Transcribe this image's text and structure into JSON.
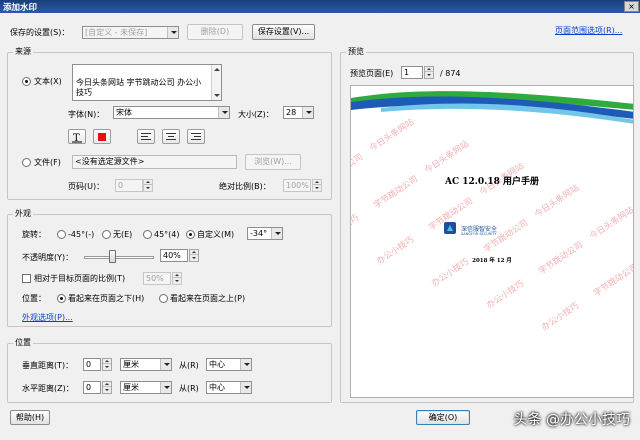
{
  "window": {
    "title": "添加水印",
    "close": "×"
  },
  "saved_settings": {
    "label": "保存的设置(S)：",
    "value": "[自定义 - 未保存]",
    "delete": "删除(D)",
    "save": "保存设置(V)..."
  },
  "page_range_link": "页面范围选项(R)...",
  "source": {
    "group_title": "来源",
    "text_radio": "文本(X)",
    "text_lines": [
      "今日头条网站  字节跳动公司  办公小",
      "技巧"
    ],
    "font_label": "字体(N)：",
    "font_value": "宋体",
    "size_label": "大小(Z)：",
    "size_value": "28",
    "file_radio": "文件(F)",
    "file_value": "<没有选定源文件>",
    "browse": "浏览(W)...",
    "page_label": "页码(U)：",
    "page_value": "0",
    "abs_scale_label": "绝对比例(B)：",
    "abs_scale_value": "100%"
  },
  "appearance": {
    "group_title": "外观",
    "rotation_label": "旋转：",
    "rot_neg45": "-45°(-)",
    "rot_none": "无(E)",
    "rot_45": "45°(4)",
    "rot_custom": "自定义(M)",
    "rot_value": "-34°",
    "opacity_label": "不透明度(Y)：",
    "opacity_value": "40%",
    "opacity_fraction": 0.4,
    "relative_label": "相对于目标页面的比例(T)",
    "relative_value": "50%",
    "position_label": "位置：",
    "pos_behind": "看起来在页面之下(H)",
    "pos_front": "看起来在页面之上(P)",
    "options_link": "外观选项(P)..."
  },
  "position": {
    "group_title": "位置",
    "vdist_label": "垂直距离(T)：",
    "vdist_value": "0",
    "vunit": "厘米",
    "vfrom_label": "从(R)",
    "vfrom_value": "中心",
    "hdist_label": "水平距离(Z)：",
    "hdist_value": "0",
    "hunit": "厘米",
    "hfrom_label": "从(R)",
    "hfrom_value": "中心"
  },
  "preview": {
    "group_title": "预览",
    "page_label": "预览页面(E)",
    "page_value": "1",
    "page_total": "/ 874",
    "doc_title": "AC 12.0.18 用户手册",
    "org_name": "深信服智安全",
    "org_sub": "SANGFOR SECURITY",
    "doc_date": "2018 年 12 月",
    "watermark_parts": [
      "今日头条网站",
      "字节跳动公司",
      "办公小技巧"
    ],
    "wave_colors": [
      "#2faa3d",
      "#1e5bb6",
      "#73c6e8"
    ],
    "watermark_color": "#f2aeb0"
  },
  "buttons": {
    "help": "帮助(H)",
    "ok": "确定(O)"
  },
  "overlay_credit": "头条 @办公小技巧"
}
